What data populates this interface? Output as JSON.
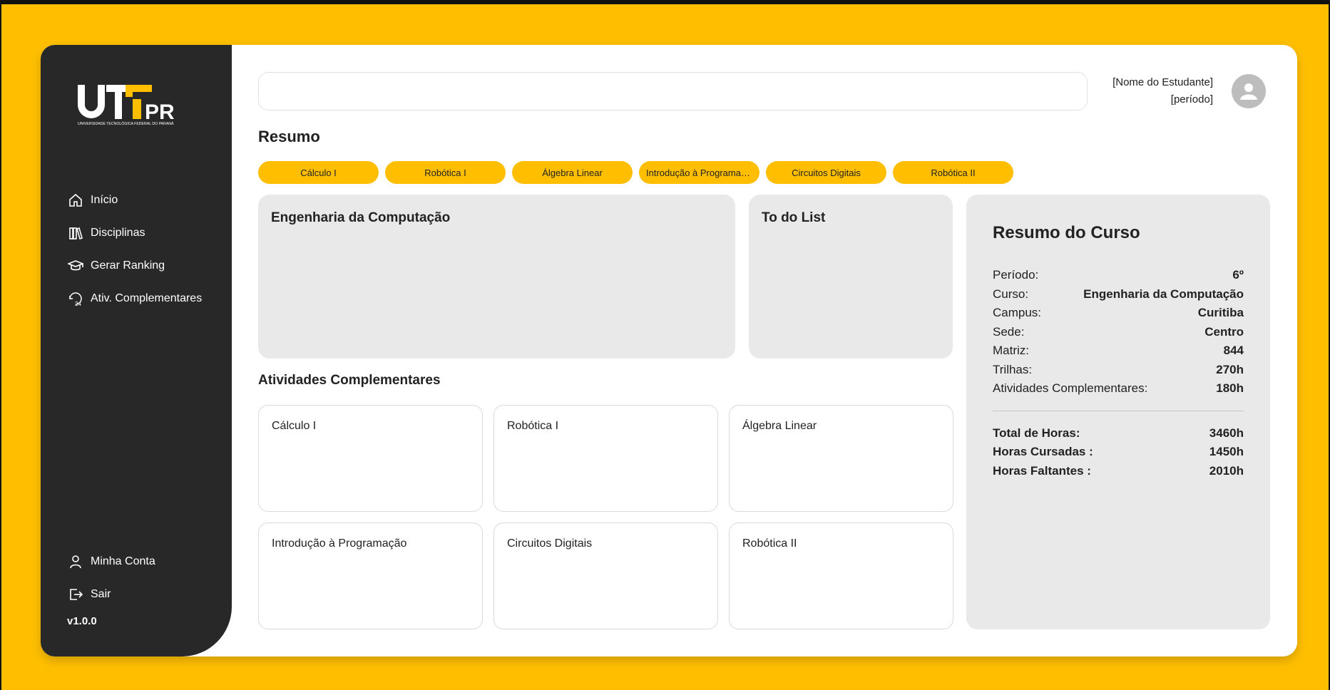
{
  "colors": {
    "accent": "#FFBF00",
    "sidebar": "#282828",
    "panel": "#e9e9e9"
  },
  "logo": {
    "text": "UTFPR",
    "subtitle": "UNIVERSIDADE TECNOLÓGICA FEDERAL DO PARANÁ"
  },
  "sidebar": {
    "items": [
      {
        "label": "Início",
        "icon": "home-icon"
      },
      {
        "label": "Disciplinas",
        "icon": "books-icon"
      },
      {
        "label": "Gerar Ranking",
        "icon": "graduation-cap-icon"
      },
      {
        "label": "Ativ. Complementares",
        "icon": "clock-24-icon"
      }
    ],
    "bottom": [
      {
        "label": "Minha Conta",
        "icon": "user-icon"
      },
      {
        "label": "Sair",
        "icon": "logout-icon"
      }
    ],
    "version": "v1.0.0"
  },
  "search": {
    "value": "",
    "placeholder": ""
  },
  "user": {
    "name": "[Nome do Estudante]",
    "period": "[período]"
  },
  "resumo": {
    "title": "Resumo",
    "chips": [
      "Cálculo I",
      "Robótica I",
      "Álgebra Linear",
      "Introdução à Programação",
      "Circuitos Digitais",
      "Robótica II"
    ]
  },
  "panels": {
    "course": "Engenharia da Computação",
    "todo": "To do List"
  },
  "atividades": {
    "title": "Atividades Complementares",
    "cards": [
      "Cálculo I",
      "Robótica I",
      "Álgebra Linear",
      "Introdução à Programação",
      "Circuitos Digitais",
      "Robótica II"
    ]
  },
  "resumo_curso": {
    "title": "Resumo do Curso",
    "rows": [
      {
        "k": "Período:",
        "v": "6º"
      },
      {
        "k": "Curso:",
        "v": "Engenharia da Computação"
      },
      {
        "k": "Campus:",
        "v": "Curitiba"
      },
      {
        "k": "Sede:",
        "v": "Centro"
      },
      {
        "k": "Matriz:",
        "v": "844"
      },
      {
        "k": "Trilhas:",
        "v": "270h"
      },
      {
        "k": "Atividades Complementares:",
        "v": "180h"
      }
    ],
    "totals": [
      {
        "k": "Total de Horas:",
        "v": "3460h"
      },
      {
        "k": "Horas Cursadas :",
        "v": "1450h"
      },
      {
        "k": "Horas Faltantes :",
        "v": "2010h"
      }
    ]
  }
}
